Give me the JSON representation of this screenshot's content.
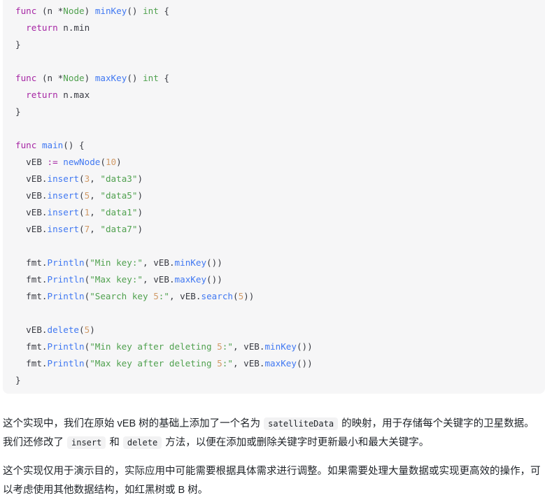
{
  "code_block": {
    "language": "go",
    "background": "#f6f6f7",
    "colors": {
      "keyword": "#a626a4",
      "function": "#4078f2",
      "type": "#50a14f",
      "string": "#50a14f",
      "number": "#d19a66",
      "plain": "#383a42"
    },
    "lines": [
      {
        "id": "l1",
        "text": "func (n *Node) minKey() int {"
      },
      {
        "id": "l2",
        "text": "  return n.min"
      },
      {
        "id": "l3",
        "text": "}"
      },
      {
        "id": "l4",
        "text": ""
      },
      {
        "id": "l5",
        "text": "func (n *Node) maxKey() int {"
      },
      {
        "id": "l6",
        "text": "  return n.max"
      },
      {
        "id": "l7",
        "text": "}"
      },
      {
        "id": "l8",
        "text": ""
      },
      {
        "id": "l9",
        "text": "func main() {"
      },
      {
        "id": "l10",
        "text": "  vEB := newNode(10)"
      },
      {
        "id": "l11",
        "text": "  vEB.insert(3, \"data3\")"
      },
      {
        "id": "l12",
        "text": "  vEB.insert(5, \"data5\")"
      },
      {
        "id": "l13",
        "text": "  vEB.insert(1, \"data1\")"
      },
      {
        "id": "l14",
        "text": "  vEB.insert(7, \"data7\")"
      },
      {
        "id": "l15",
        "text": ""
      },
      {
        "id": "l16",
        "text": "  fmt.Println(\"Min key:\", vEB.minKey())"
      },
      {
        "id": "l17",
        "text": "  fmt.Println(\"Max key:\", vEB.maxKey())"
      },
      {
        "id": "l18",
        "text": "  fmt.Println(\"Search key 5:\", vEB.search(5))"
      },
      {
        "id": "l19",
        "text": ""
      },
      {
        "id": "l20",
        "text": "  vEB.delete(5)"
      },
      {
        "id": "l21",
        "text": "  fmt.Println(\"Min key after deleting 5:\", vEB.minKey())"
      },
      {
        "id": "l22",
        "text": "  fmt.Println(\"Max key after deleting 5:\", vEB.maxKey())"
      },
      {
        "id": "l23",
        "text": "}"
      }
    ]
  },
  "paragraphs": {
    "p1": {
      "part1": "这个实现中，我们在原始 vEB 树的基础上添加了一个名为",
      "code1": "satelliteData",
      "part2": "的映射，用于存储每个关键字的卫星数据。我们还修改了",
      "code2": "insert",
      "part3": "和",
      "code3": "delete",
      "part4": "方法，以便在添加或删除关键字时更新最小和最大关键字。"
    },
    "p2": {
      "text": "这个实现仅用于演示目的，实际应用中可能需要根据具体需求进行调整。如果需要处理大量数据或实现更高效的操作，可以考虑使用其他数据结构，如红黑树或 B 树。"
    }
  }
}
